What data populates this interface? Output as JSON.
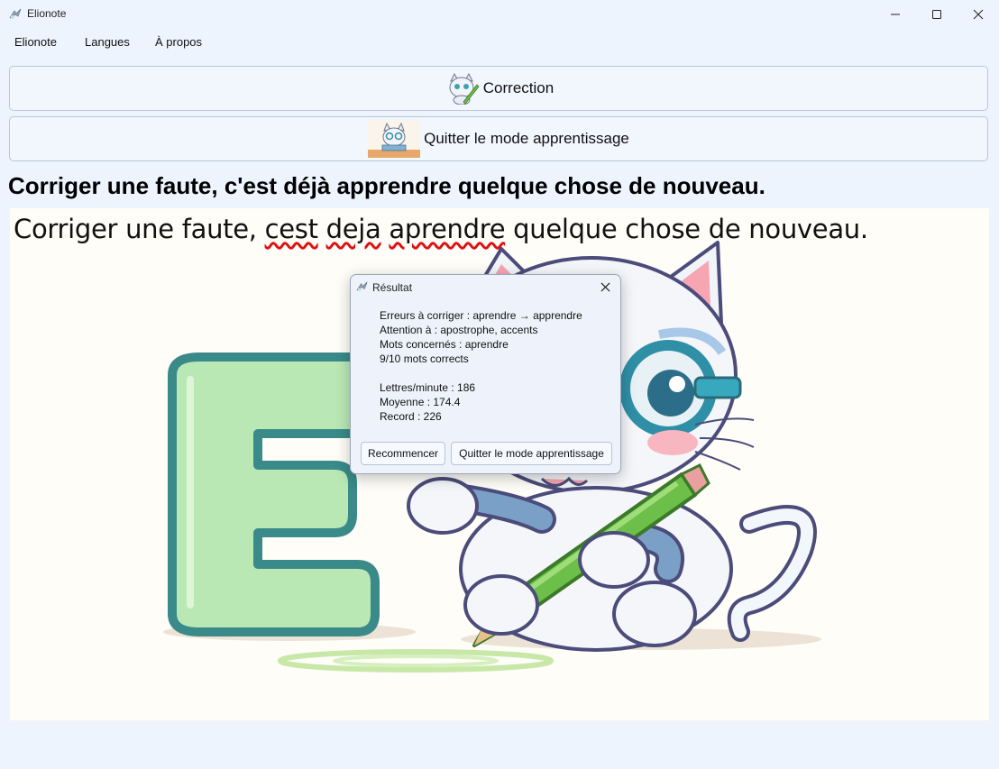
{
  "window": {
    "title": "Elionote",
    "minimize_icon": "minimize-icon",
    "maximize_icon": "maximize-icon",
    "close_icon": "close-icon"
  },
  "menu": {
    "items": [
      {
        "label": "Elionote"
      },
      {
        "label": "Langues"
      },
      {
        "label": "À propos"
      }
    ]
  },
  "buttons": {
    "correction": {
      "label": "Correction",
      "icon": "cat-pencil-icon"
    },
    "quit_learning": {
      "label": "Quitter le mode apprentissage",
      "icon": "cat-glasses-icon"
    }
  },
  "model_sentence": "Corriger une faute, c'est déjà apprendre quelque chose de nouveau.",
  "typed_sentence": {
    "part1": "Corriger une faute, ",
    "err1": "cest",
    "sp1": " ",
    "err2": "deja",
    "sp2": " ",
    "err3": "aprendre",
    "part2": " quelque chose de nouveau."
  },
  "illustration": {
    "name": "cat-with-letter-e-and-pencil",
    "letter": "E"
  },
  "dialog": {
    "title": "Résultat",
    "lines": [
      "Erreurs à corriger : aprendre → apprendre",
      "Attention à : apostrophe, accents",
      "Mots concernés : aprendre",
      "9/10 mots corrects",
      "Lettres/minute : 186",
      "Moyenne : 174.4",
      "Record : 226"
    ],
    "restart_label": "Recommencer",
    "quit_label": "Quitter le mode apprentissage"
  },
  "colors": {
    "background": "#eef4fe",
    "button_border": "#b8c6dc",
    "spell_error": "#dd1111"
  }
}
